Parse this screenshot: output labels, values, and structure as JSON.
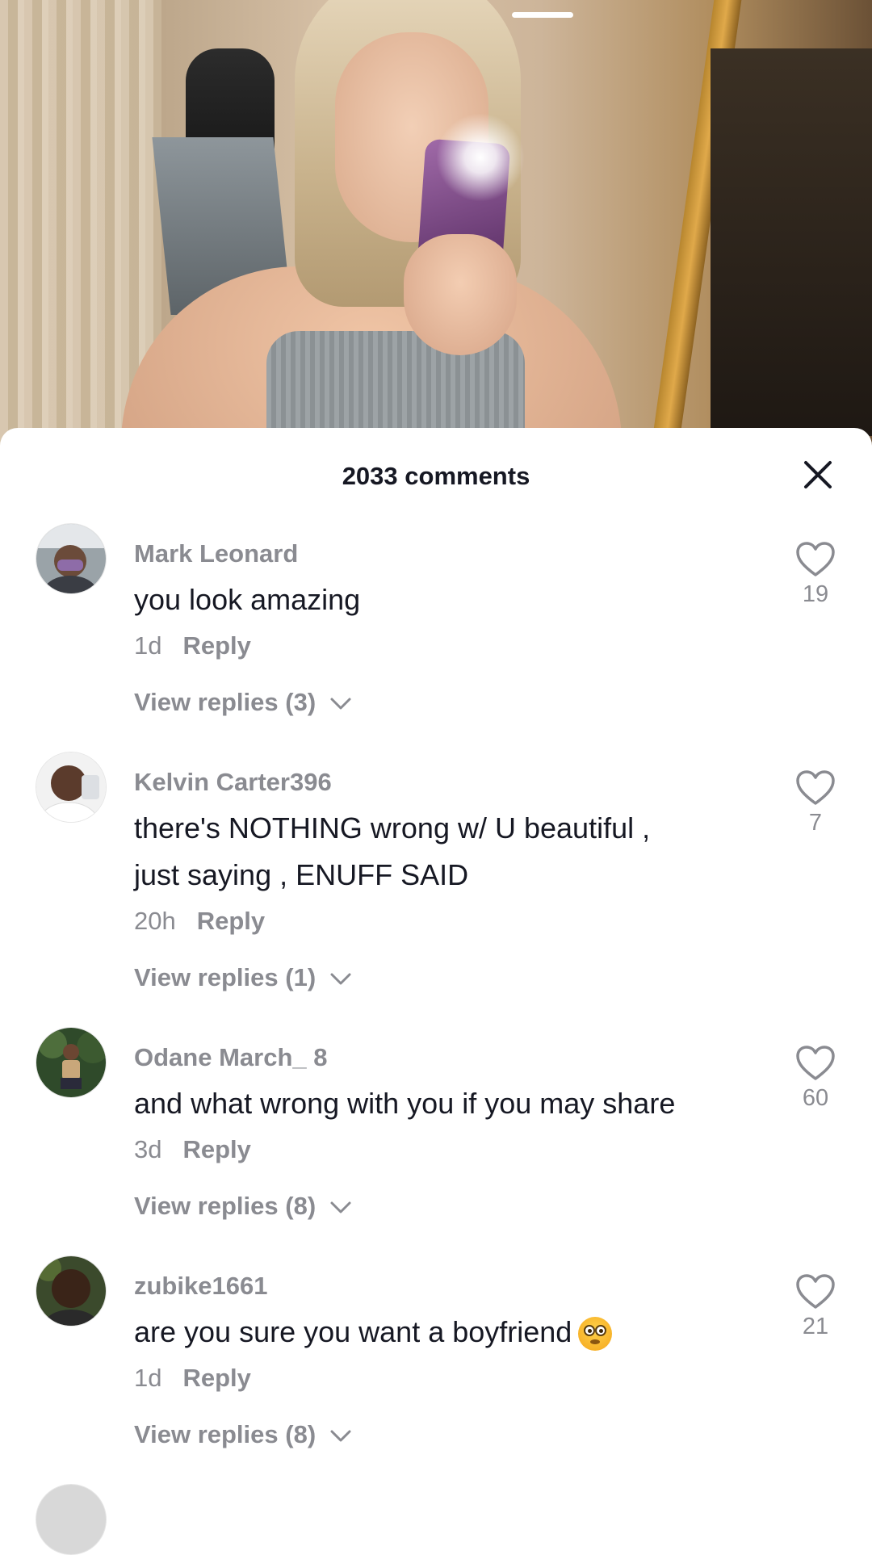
{
  "sheet": {
    "title": "2033 comments"
  },
  "comments": [
    {
      "username": "Mark Leonard",
      "text": "you look amazing",
      "time": "1d",
      "reply_label": "Reply",
      "view_replies": "View replies (3)",
      "likes": "19"
    },
    {
      "username": "Kelvin Carter396",
      "text_line1": "there's NOTHING wrong w/ U beautiful ,",
      "text_line2": "just saying , ENUFF SAID",
      "time": "20h",
      "reply_label": "Reply",
      "view_replies": "View replies (1)",
      "likes": "7"
    },
    {
      "username": "Odane March_ 8",
      "text": "and what wrong with you if you may share",
      "time": "3d",
      "reply_label": "Reply",
      "view_replies": "View replies (8)",
      "likes": "60"
    },
    {
      "username": "zubike1661",
      "text": "are you sure you want a boyfriend",
      "emoji": "flushed-face",
      "time": "1d",
      "reply_label": "Reply",
      "view_replies": "View replies (8)",
      "likes": "21"
    }
  ],
  "icons": {
    "close": "close-icon",
    "like": "heart-outline-icon",
    "expand": "chevron-down-icon"
  },
  "colors": {
    "primary_text": "#161823",
    "secondary_text": "#8a8b91",
    "background": "#ffffff"
  }
}
